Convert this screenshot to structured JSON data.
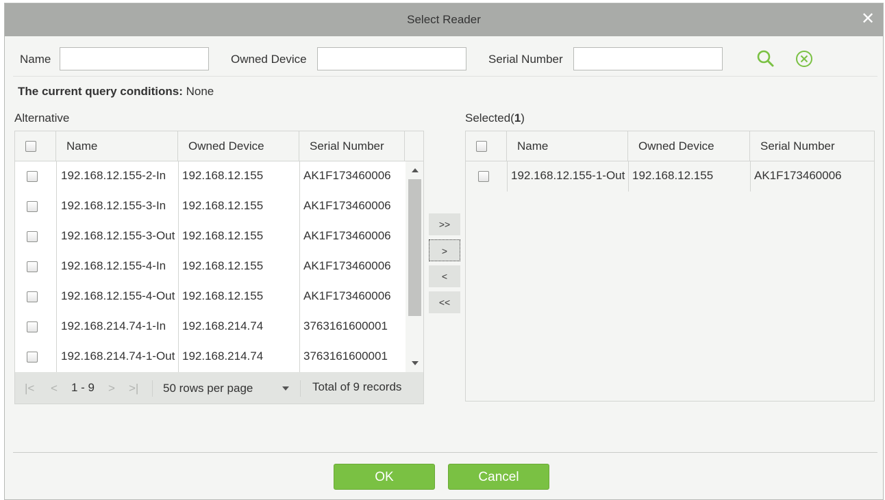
{
  "dialog": {
    "title": "Select Reader",
    "close_icon": "close-icon"
  },
  "search": {
    "name_label": "Name",
    "name_value": "",
    "owned_device_label": "Owned Device",
    "owned_device_value": "",
    "serial_label": "Serial Number",
    "serial_value": "",
    "search_icon": "search-icon",
    "clear_icon": "clear-circle-icon",
    "accent_color": "#7ac143"
  },
  "query": {
    "prefix": "The current query conditions:",
    "value": "None"
  },
  "alternative": {
    "heading": "Alternative",
    "columns": [
      "Name",
      "Owned Device",
      "Serial Number"
    ],
    "rows": [
      {
        "name": "192.168.12.155-2-In",
        "device": "192.168.12.155",
        "serial": "AK1F173460006"
      },
      {
        "name": "192.168.12.155-3-In",
        "device": "192.168.12.155",
        "serial": "AK1F173460006"
      },
      {
        "name": "192.168.12.155-3-Out",
        "device": "192.168.12.155",
        "serial": "AK1F173460006"
      },
      {
        "name": "192.168.12.155-4-In",
        "device": "192.168.12.155",
        "serial": "AK1F173460006"
      },
      {
        "name": "192.168.12.155-4-Out",
        "device": "192.168.12.155",
        "serial": "AK1F173460006"
      },
      {
        "name": "192.168.214.74-1-In",
        "device": "192.168.214.74",
        "serial": "3763161600001"
      },
      {
        "name": "192.168.214.74-1-Out",
        "device": "192.168.214.74",
        "serial": "3763161600001"
      }
    ],
    "pager": {
      "first": "|<",
      "prev": "<",
      "range": "1 - 9",
      "next": ">",
      "last": ">|",
      "page_size": "50 rows per page",
      "total": "Total of 9 records"
    }
  },
  "move_buttons": {
    "all_right": ">>",
    "right": ">",
    "left": "<",
    "all_left": "<<"
  },
  "selected": {
    "heading_prefix": "Selected(",
    "count": "1",
    "heading_suffix": ")",
    "columns": [
      "Name",
      "Owned Device",
      "Serial Number"
    ],
    "rows": [
      {
        "name": "192.168.12.155-1-Out",
        "device": "192.168.12.155",
        "serial": "AK1F173460006"
      }
    ]
  },
  "footer": {
    "ok": "OK",
    "cancel": "Cancel"
  }
}
